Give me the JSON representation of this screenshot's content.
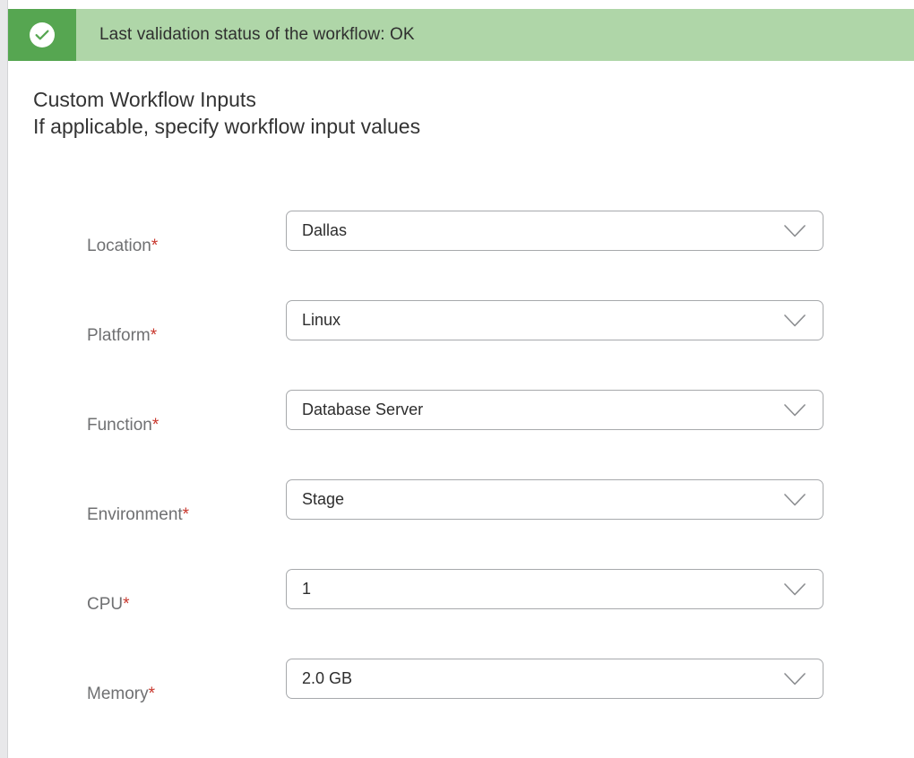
{
  "status_banner": {
    "icon": "check-circle-icon",
    "message": "Last validation status of the workflow: OK",
    "icon_box_color": "#56a651",
    "background_color": "#afd6a8"
  },
  "heading": {
    "title": "Custom Workflow Inputs",
    "subtitle": "If applicable, specify workflow input values"
  },
  "form": {
    "required_marker": "*",
    "chevron_icon": "chevron-down-icon",
    "fields": [
      {
        "label": "Location",
        "value": "Dallas",
        "required": true
      },
      {
        "label": "Platform",
        "value": "Linux",
        "required": true
      },
      {
        "label": "Function",
        "value": "Database Server",
        "required": true
      },
      {
        "label": "Environment",
        "value": "Stage",
        "required": true
      },
      {
        "label": "CPU",
        "value": "1",
        "required": true
      },
      {
        "label": "Memory",
        "value": "2.0 GB",
        "required": true
      }
    ]
  },
  "colors": {
    "label_gray": "#6f7072",
    "required_red": "#c8372d",
    "value_text": "#2d2d2d",
    "border_gray": "#a7a9ac",
    "heading_text": "#333333"
  }
}
